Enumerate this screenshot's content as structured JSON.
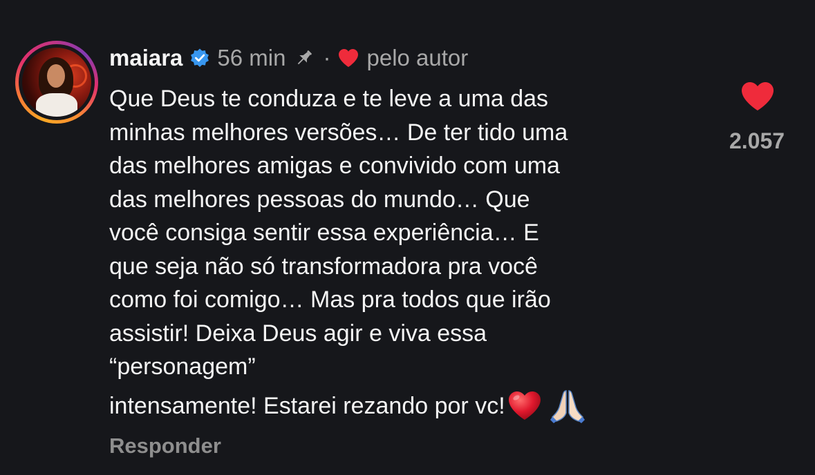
{
  "comment": {
    "username": "maiara",
    "verified": true,
    "time": "56 min",
    "separator": "·",
    "by_author_label": "pelo autor",
    "lines": [
      "Que Deus te conduza e te leve a uma das",
      "minhas melhores versões… De ter tido uma",
      "das melhores amigas e convivido com uma",
      "das melhores pessoas do mundo… Que",
      "você consiga sentir essa experiência… E",
      "que seja não só transformadora pra você",
      "como foi comigo… Mas pra todos que irão",
      "assistir! Deixa Deus agir e viva essa",
      "“personagem”"
    ],
    "last_line": "intensamente! Estarei rezando por vc!",
    "emojis": [
      "red-heart",
      "folded-hands"
    ],
    "reply_label": "Responder",
    "like_count": "2.057"
  },
  "icons": {
    "verified": "verified-badge-icon",
    "pin": "pin-icon",
    "author_like": "heart-icon",
    "like": "heart-icon"
  },
  "colors": {
    "background": "#16171b",
    "text": "#f5f5f5",
    "muted": "#a8a8a8",
    "heart": "#ef2b3b",
    "verified": "#3897f0"
  }
}
